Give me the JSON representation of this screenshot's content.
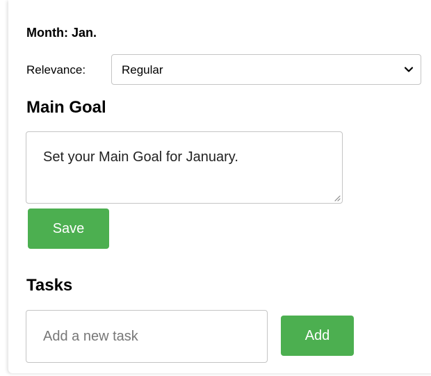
{
  "month": {
    "title": "Month: Jan."
  },
  "relevance": {
    "label": "Relevance:",
    "selected": "Regular"
  },
  "main_goal": {
    "heading": "Main Goal",
    "value": "Set your Main Goal for January.",
    "save_label": "Save"
  },
  "tasks": {
    "heading": "Tasks",
    "input_placeholder": "Add a new task",
    "add_label": "Add"
  },
  "colors": {
    "accent": "#4caf50",
    "border": "#c4c4c4",
    "placeholder": "#777777"
  },
  "icons": {
    "select": "chevron-down-icon",
    "textarea": "resize-grip-icon"
  }
}
